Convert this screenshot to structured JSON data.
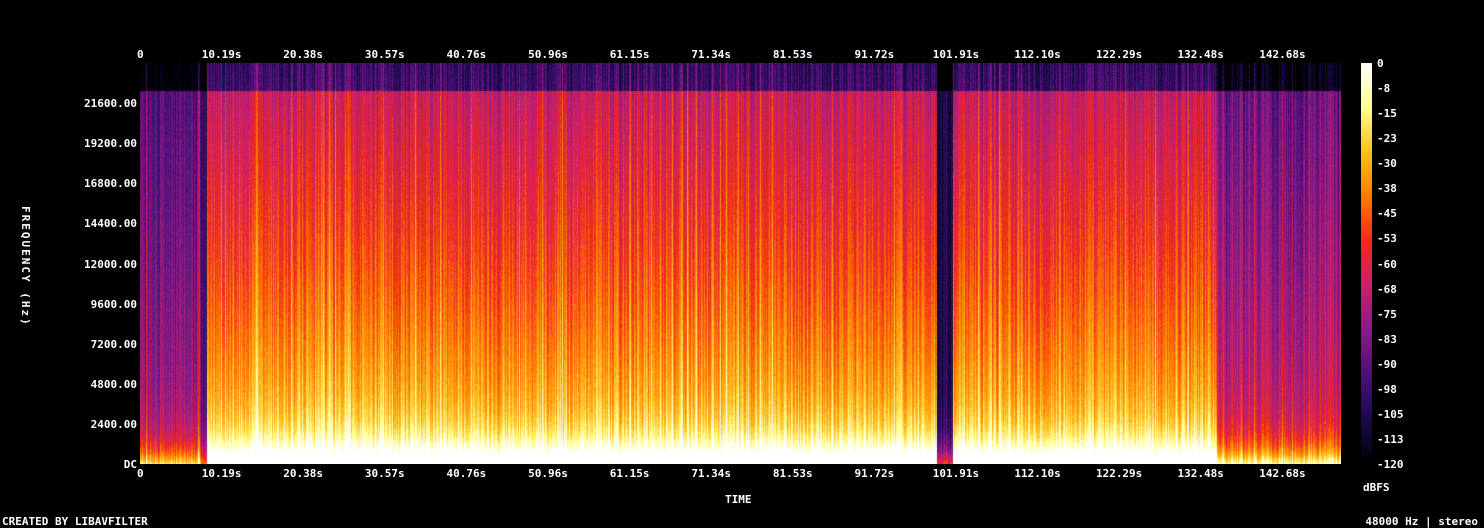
{
  "chart_data": {
    "type": "heatmap",
    "xlabel": "TIME",
    "ylabel": "FREQUENCY (Hz)",
    "x_ticks": [
      "0",
      "10.19s",
      "20.38s",
      "30.57s",
      "40.76s",
      "50.96s",
      "61.15s",
      "71.34s",
      "81.53s",
      "91.72s",
      "101.91s",
      "112.10s",
      "122.29s",
      "132.48s",
      "142.68s"
    ],
    "x_tick_values": [
      0,
      10.19,
      20.38,
      30.57,
      40.76,
      50.96,
      61.15,
      71.34,
      81.53,
      91.72,
      101.91,
      112.1,
      122.29,
      132.48,
      142.68
    ],
    "xlim": [
      0,
      150
    ],
    "y_ticks": [
      "DC",
      "2400.00",
      "4800.00",
      "7200.00",
      "9600.00",
      "12000.00",
      "14400.00",
      "16800.00",
      "19200.00",
      "21600.00"
    ],
    "y_tick_values": [
      0,
      2400,
      4800,
      7200,
      9600,
      12000,
      14400,
      16800,
      19200,
      21600
    ],
    "ylim": [
      0,
      24000
    ],
    "colorbar": {
      "label": "dBFS",
      "range": [
        -120,
        0
      ],
      "ticks": [
        "0",
        "-8",
        "-15",
        "-23",
        "-30",
        "-38",
        "-45",
        "-53",
        "-60",
        "-68",
        "-75",
        "-83",
        "-90",
        "-98",
        "-105",
        "-113",
        "-120"
      ],
      "tick_values": [
        0,
        -7.5,
        -15,
        -22.5,
        -30,
        -37.5,
        -45,
        -52.5,
        -60,
        -67.5,
        -75,
        -82.5,
        -90,
        -97.5,
        -105,
        -112.5,
        -120
      ],
      "colors": [
        "#000000",
        "#1a0a4a",
        "#4b0f7a",
        "#8a1a86",
        "#c8206a",
        "#f0281e",
        "#ff7a00",
        "#ffc020",
        "#ffff90",
        "#ffffff"
      ]
    },
    "segments": [
      {
        "start": 0,
        "end": 7.5,
        "level": 0.35
      },
      {
        "start": 7.5,
        "end": 8.3,
        "level": 0.15
      },
      {
        "start": 8.3,
        "end": 99.5,
        "level": 0.8
      },
      {
        "start": 99.5,
        "end": 101.5,
        "level": 0.05
      },
      {
        "start": 101.5,
        "end": 134.5,
        "level": 0.8
      },
      {
        "start": 134.5,
        "end": 150,
        "level": 0.45
      }
    ]
  },
  "footer": {
    "left": "CREATED BY LIBAVFILTER",
    "right": "48000 Hz | stereo"
  }
}
